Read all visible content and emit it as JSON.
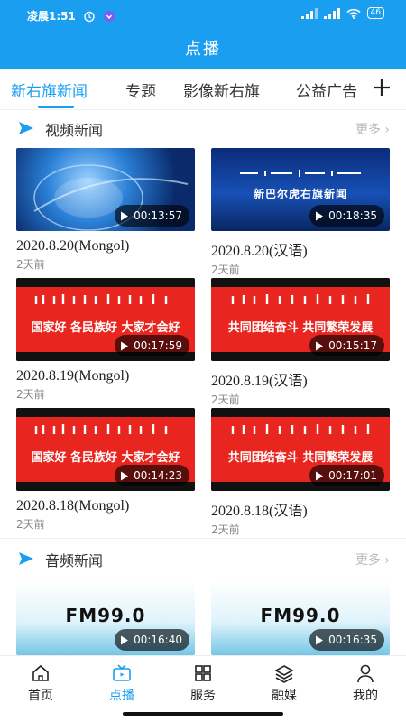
{
  "status_bar": {
    "time": "凌晨1:51",
    "battery": "46"
  },
  "app_title": "点播",
  "tabs": [
    {
      "label": "新右旗新闻",
      "active": true
    },
    {
      "label": "专题",
      "active": false
    },
    {
      "label": "影像新右旗",
      "active": false
    },
    {
      "label": "公益广告",
      "active": false
    }
  ],
  "sections": [
    {
      "title": "视频新闻",
      "more": "更多",
      "items": [
        {
          "title": "2020.8.20(Mongol)",
          "date": "2天前",
          "duration": "00:13:57",
          "thumb_style": "blue-globe"
        },
        {
          "title": "2020.8.20(汉语)",
          "date": "2天前",
          "duration": "00:18:35",
          "thumb_style": "blue-title",
          "thumb_text": "新巴尔虎右旗新闻"
        },
        {
          "title": "2020.8.19(Mongol)",
          "date": "2天前",
          "duration": "00:17:59",
          "thumb_style": "red-banner",
          "thumb_text": "国家好  各民族好  大家才会好"
        },
        {
          "title": "2020.8.19(汉语)",
          "date": "2天前",
          "duration": "00:15:17",
          "thumb_style": "red-banner",
          "thumb_text": "共同团结奋斗  共同繁荣发展"
        },
        {
          "title": "2020.8.18(Mongol)",
          "date": "2天前",
          "duration": "00:14:23",
          "thumb_style": "red-banner",
          "thumb_text": "国家好  各民族好  大家才会好"
        },
        {
          "title": "2020.8.18(汉语)",
          "date": "2天前",
          "duration": "00:17:01",
          "thumb_style": "red-banner",
          "thumb_text": "共同团结奋斗  共同繁荣发展"
        }
      ]
    },
    {
      "title": "音频新闻",
      "more": "更多",
      "items": [
        {
          "duration": "00:16:40",
          "thumb_style": "fm",
          "thumb_text": "FM99.0"
        },
        {
          "duration": "00:16:35",
          "thumb_style": "fm",
          "thumb_text": "FM99.0"
        }
      ]
    }
  ],
  "bottom_nav": [
    {
      "label": "首页",
      "icon": "home-icon",
      "active": false
    },
    {
      "label": "点播",
      "icon": "tv-icon",
      "active": true
    },
    {
      "label": "服务",
      "icon": "grid-icon",
      "active": false
    },
    {
      "label": "融媒",
      "icon": "layers-icon",
      "active": false
    },
    {
      "label": "我的",
      "icon": "user-icon",
      "active": false
    }
  ],
  "colors": {
    "primary": "#1a9ff0",
    "thumb_red": "#e8261f",
    "muted": "#888888"
  }
}
